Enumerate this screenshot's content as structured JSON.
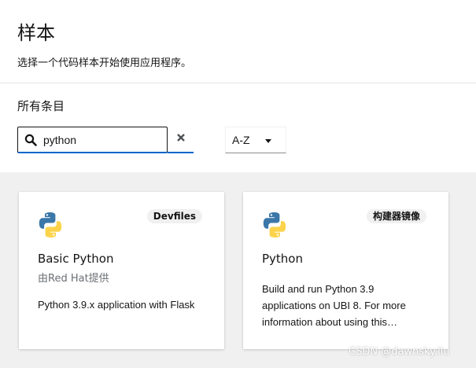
{
  "header": {
    "title": "样本",
    "description": "选择一个代码样本开始使用应用程序。"
  },
  "catalog": {
    "section_title": "所有条目",
    "search": {
      "value": "python",
      "icon": "search-icon"
    },
    "clear_icon": "close-icon",
    "sort": {
      "selected": "A-Z"
    }
  },
  "cards": [
    {
      "title": "Basic Python",
      "badge": "Devfiles",
      "provider": "由Red Hat提供",
      "description": "Python 3.9.x application with Flask",
      "logo": "python-logo-icon"
    },
    {
      "title": "Python",
      "badge": "构建器镜像",
      "provider": "",
      "description": "Build and run Python 3.9 applications on UBI 8. For more information about using this…",
      "logo": "python-logo-icon"
    }
  ],
  "watermark": "CSDN @dawnsky.liu",
  "colors": {
    "python_blue": "#3b77a8",
    "python_yellow": "#fcd34b",
    "focus_blue": "#0066cc",
    "gallery_bg": "#f0f0f0"
  }
}
